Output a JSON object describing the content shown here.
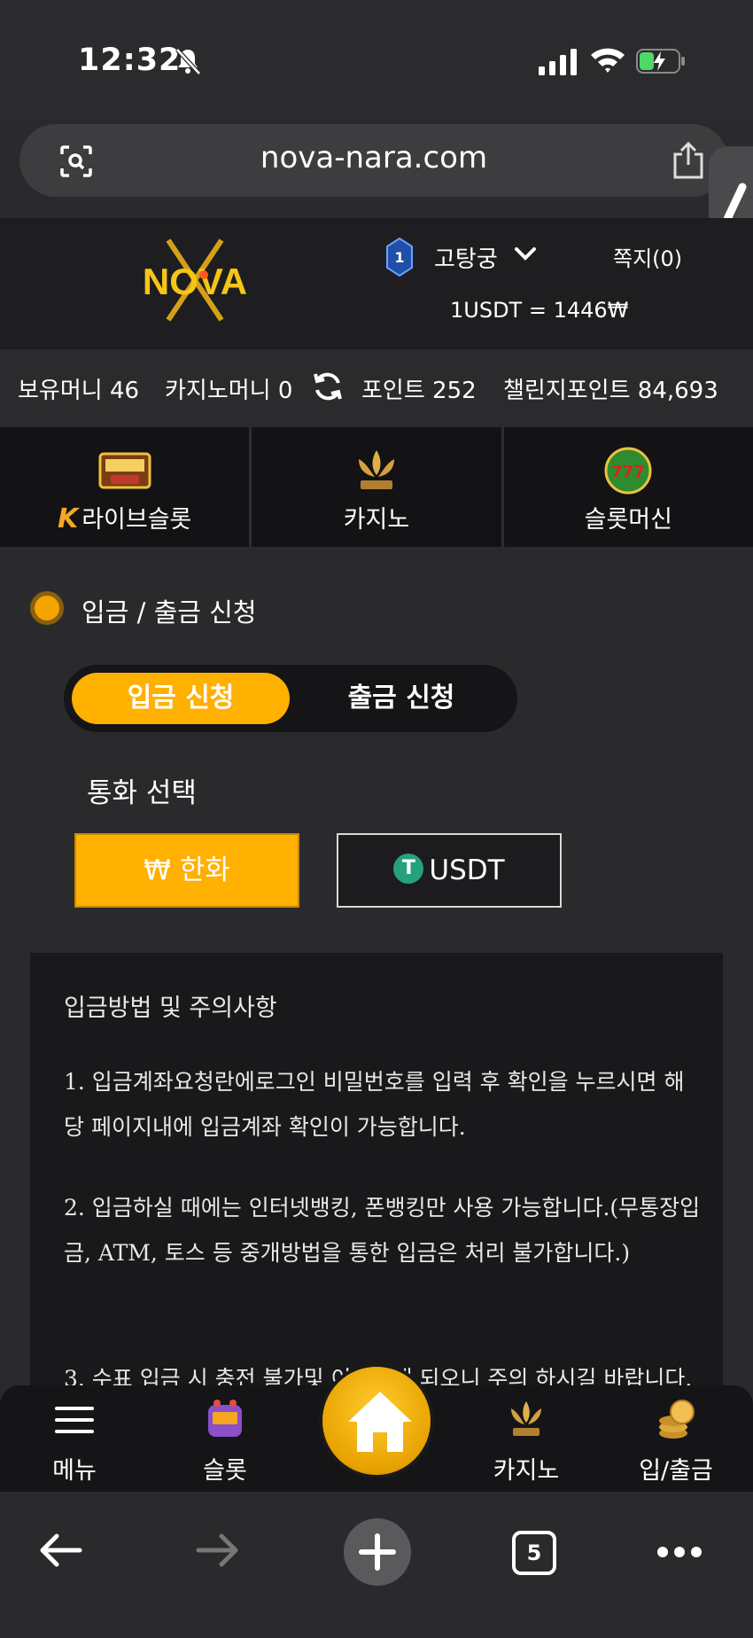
{
  "status_bar": {
    "time": "12:32"
  },
  "browser": {
    "url": "nova-nara.com",
    "tab_count": "5"
  },
  "header": {
    "logo_text": "NOVA",
    "rank": "1",
    "username": "고탕궁",
    "messages": "쪽지(0)",
    "exchange_rate": "1USDT = 1446₩"
  },
  "balances": {
    "holding": "보유머니 46",
    "casino": "카지노머니 0",
    "points": "포인트 252",
    "challenge_points": "챌린지포인트 84,693"
  },
  "categories": [
    {
      "label": "라이브슬롯",
      "icon": "live-slot-icon"
    },
    {
      "label": "카지노",
      "icon": "casino-icon"
    },
    {
      "label": "슬롯머신",
      "icon": "slot-machine-icon"
    }
  ],
  "section": {
    "title": "입금 / 출금 신청"
  },
  "tabs": {
    "deposit": "입금 신청",
    "withdraw": "출금 신청",
    "active": "deposit"
  },
  "currency": {
    "label": "통화 선택",
    "krw": "₩ 한화",
    "usdt": "USDT",
    "selected": "krw"
  },
  "notice": {
    "title": "입금방법 및 주의사항",
    "items": [
      "1. 입금계좌요청란에로그인 비밀번호를 입력 후 확인을 누르시면 해당 페이지내에 입금계좌 확인이 가능합니다.",
      "2. 입금하실 때에는 인터넷뱅킹, 폰뱅킹만 사용 가능합니다.(무통장입금, ATM, 토스 등 중개방법을 통한 입금은 처리 불가합니다.)",
      "3. 수표 입금 시 충전 불가및 이용제재 되오니 주의 하시길 바랍니다."
    ]
  },
  "bottom_nav": {
    "menu": "메뉴",
    "slot": "슬롯",
    "casino": "카지노",
    "deposit_withdraw": "입/출금"
  },
  "colors": {
    "accent": "#ffb000",
    "header_bg": "#1e1e20",
    "tether": "#26a17b"
  }
}
